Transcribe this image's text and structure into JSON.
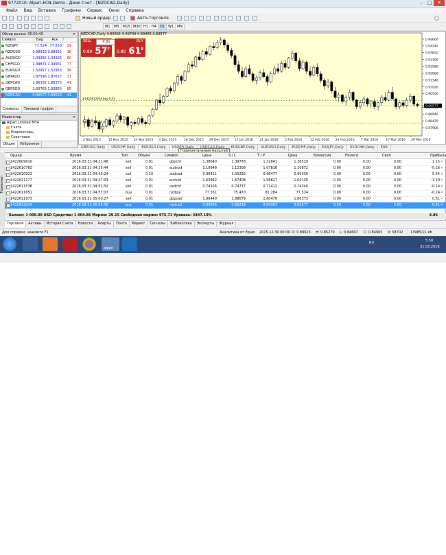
{
  "window": {
    "title": "9772010: Alpari-ECN-Demo - Демо Счет - [NZDCAD,Daily]"
  },
  "menu": [
    "Файл",
    "Вид",
    "Вставка",
    "Графики",
    "Сервис",
    "Окно",
    "Справка"
  ],
  "toolbar": {
    "new_order": "Новый ордер",
    "autotrading": "Авто-торговля"
  },
  "timeframes": [
    "M1",
    "M5",
    "M15",
    "M30",
    "H1",
    "H4",
    "D1",
    "W1",
    "MN"
  ],
  "market_watch": {
    "header": "Обзор рынка: 05:50:43",
    "col_symbol": "Символ",
    "col_bid": "Бид",
    "col_ask": "Аск",
    "rows": [
      {
        "sym": "NZDJPY",
        "bid": "77.524",
        "ask": "77.553",
        "spr": "29"
      },
      {
        "sym": "NZDUSD",
        "bid": "0.68933",
        "ask": "0.68951",
        "spr": "18"
      },
      {
        "sym": "AUDSGD",
        "bid": "1.03265",
        "ask": "1.03325",
        "spr": "60"
      },
      {
        "sym": "CHFSGD",
        "bid": "1.39874",
        "ask": "1.39951",
        "spr": "77"
      },
      {
        "sym": "EURSGD",
        "bid": "1.52917",
        "ask": "1.52953",
        "spr": "36"
      },
      {
        "sym": "GBPAUD",
        "bid": "1.87596",
        "ask": "1.87627",
        "spr": "31"
      },
      {
        "sym": "GBPCAD",
        "bid": "1.86332",
        "ask": "1.86373",
        "spr": "41"
      },
      {
        "sym": "GBPSGD",
        "bid": "1.93765",
        "ask": "1.93850",
        "spr": "85"
      },
      {
        "sym": "NZDCAD",
        "bid": "0.89577",
        "ask": "0.89618",
        "spr": "41"
      }
    ],
    "tabs": [
      "Символы",
      "Тиковый график"
    ]
  },
  "navigator": {
    "header": "Навигатор",
    "items": [
      "Alpari Limited MT4",
      "Счета",
      "Индикаторы",
      "Советники"
    ],
    "tabs": [
      "Общие",
      "Избранное"
    ]
  },
  "chart": {
    "title": "NZDCAD,Daily  0.89691 0.89799 0.89465 0.89577",
    "sell_label": "SELL",
    "buy_label": "BUY",
    "lot": "0.01",
    "sell_price_small": "0.89",
    "sell_price_big": "57",
    "sell_sup": "7",
    "buy_price_small": "0.89",
    "buy_price_big": "61",
    "buy_sup": "8",
    "order_line_label": "#1422612034 buy 0.01",
    "order_line_label2": "#1422612034 sl",
    "price_labels": [
      "0.94660",
      "0.94140",
      "0.93620",
      "0.93100",
      "0.92580",
      "0.92060",
      "0.91540",
      "0.91020",
      "0.90500",
      "0.89577",
      "0.89460",
      "0.88940",
      "0.88420",
      "0.87900"
    ],
    "date_labels": [
      "2 Nov 2015",
      "12 Nov 2015",
      "24 Nov 2015",
      "4 Dec 2015",
      "16 Dec 2015",
      "29 Dec 2015",
      "11 Jan 2016",
      "21 Jan 2016",
      "2 Feb 2016",
      "12 Feb 2016",
      "24 Feb 2016",
      "7 Mar 2016",
      "17 Mar 2016",
      "29 Mar 2016"
    ],
    "tabs": [
      "GBPUSD,Daily",
      "USDCHF,Daily",
      "EURUSD,Daily",
      "USDJPY,Daily",
      "USDCAD,Daily",
      "EURGBP,Daily",
      "AUDUSD,Daily",
      "EURCHF,Daily",
      "EURJPY,Daily",
      "USDCNH,Daily",
      "EUR"
    ],
    "tooltip": "Горизонтальный масштаб"
  },
  "chart_data": {
    "type": "candlestick",
    "title": "NZDCAD,Daily",
    "ylim": [
      0.8738,
      0.9492
    ],
    "current_price": 0.89577,
    "order_level": 0.8996,
    "candles": [
      [
        0.884,
        0.888,
        0.879,
        0.885
      ],
      [
        0.885,
        0.887,
        0.878,
        0.88
      ],
      [
        0.88,
        0.886,
        0.879,
        0.884
      ],
      [
        0.884,
        0.888,
        0.881,
        0.883
      ],
      [
        0.883,
        0.884,
        0.876,
        0.878
      ],
      [
        0.878,
        0.882,
        0.875,
        0.88
      ],
      [
        0.88,
        0.886,
        0.879,
        0.885
      ],
      [
        0.885,
        0.887,
        0.88,
        0.881
      ],
      [
        0.881,
        0.885,
        0.879,
        0.884
      ],
      [
        0.884,
        0.89,
        0.882,
        0.888
      ],
      [
        0.888,
        0.89,
        0.883,
        0.885
      ],
      [
        0.885,
        0.888,
        0.882,
        0.887
      ],
      [
        0.887,
        0.888,
        0.879,
        0.881
      ],
      [
        0.881,
        0.884,
        0.878,
        0.883
      ],
      [
        0.883,
        0.885,
        0.88,
        0.882
      ],
      [
        0.882,
        0.887,
        0.881,
        0.886
      ],
      [
        0.886,
        0.888,
        0.881,
        0.883
      ],
      [
        0.883,
        0.885,
        0.88,
        0.882
      ],
      [
        0.882,
        0.889,
        0.881,
        0.888
      ],
      [
        0.888,
        0.894,
        0.887,
        0.893
      ],
      [
        0.893,
        0.901,
        0.892,
        0.9
      ],
      [
        0.9,
        0.905,
        0.896,
        0.898
      ],
      [
        0.898,
        0.904,
        0.897,
        0.903
      ],
      [
        0.903,
        0.91,
        0.902,
        0.909
      ],
      [
        0.909,
        0.911,
        0.905,
        0.907
      ],
      [
        0.907,
        0.914,
        0.906,
        0.913
      ],
      [
        0.913,
        0.92,
        0.911,
        0.918
      ],
      [
        0.918,
        0.919,
        0.912,
        0.915
      ],
      [
        0.915,
        0.923,
        0.914,
        0.922
      ],
      [
        0.922,
        0.929,
        0.921,
        0.927
      ],
      [
        0.927,
        0.93,
        0.924,
        0.926
      ],
      [
        0.926,
        0.934,
        0.925,
        0.933
      ],
      [
        0.933,
        0.937,
        0.93,
        0.931
      ],
      [
        0.931,
        0.938,
        0.93,
        0.937
      ],
      [
        0.937,
        0.94,
        0.933,
        0.935
      ],
      [
        0.935,
        0.942,
        0.934,
        0.941
      ],
      [
        0.941,
        0.944,
        0.938,
        0.94
      ],
      [
        0.94,
        0.946,
        0.939,
        0.944
      ],
      [
        0.944,
        0.948,
        0.942,
        0.946
      ],
      [
        0.946,
        0.947,
        0.94,
        0.942
      ],
      [
        0.942,
        0.944,
        0.936,
        0.938
      ],
      [
        0.938,
        0.94,
        0.932,
        0.934
      ],
      [
        0.934,
        0.936,
        0.925,
        0.927
      ],
      [
        0.927,
        0.93,
        0.92,
        0.922
      ],
      [
        0.922,
        0.925,
        0.916,
        0.918
      ],
      [
        0.918,
        0.926,
        0.917,
        0.924
      ],
      [
        0.924,
        0.927,
        0.919,
        0.92
      ],
      [
        0.92,
        0.922,
        0.913,
        0.915
      ],
      [
        0.915,
        0.919,
        0.912,
        0.917
      ],
      [
        0.917,
        0.923,
        0.915,
        0.921
      ],
      [
        0.921,
        0.924,
        0.917,
        0.918
      ],
      [
        0.918,
        0.92,
        0.911,
        0.914
      ],
      [
        0.914,
        0.922,
        0.913,
        0.92
      ],
      [
        0.92,
        0.926,
        0.919,
        0.924
      ],
      [
        0.924,
        0.928,
        0.92,
        0.922
      ],
      [
        0.922,
        0.93,
        0.921,
        0.928
      ],
      [
        0.928,
        0.931,
        0.923,
        0.925
      ],
      [
        0.925,
        0.933,
        0.924,
        0.932
      ],
      [
        0.932,
        0.938,
        0.93,
        0.936
      ],
      [
        0.936,
        0.937,
        0.928,
        0.93
      ],
      [
        0.93,
        0.932,
        0.922,
        0.924
      ],
      [
        0.924,
        0.931,
        0.923,
        0.929
      ],
      [
        0.929,
        0.93,
        0.92,
        0.922
      ],
      [
        0.922,
        0.926,
        0.917,
        0.919
      ],
      [
        0.919,
        0.927,
        0.918,
        0.925
      ],
      [
        0.925,
        0.928,
        0.918,
        0.92
      ],
      [
        0.92,
        0.922,
        0.913,
        0.915
      ],
      [
        0.915,
        0.917,
        0.908,
        0.911
      ],
      [
        0.911,
        0.916,
        0.909,
        0.914
      ],
      [
        0.914,
        0.915,
        0.905,
        0.907
      ],
      [
        0.907,
        0.91,
        0.9,
        0.902
      ],
      [
        0.902,
        0.906,
        0.899,
        0.904
      ],
      [
        0.904,
        0.905,
        0.897,
        0.899
      ],
      [
        0.899,
        0.904,
        0.896,
        0.902
      ],
      [
        0.902,
        0.908,
        0.9,
        0.906
      ],
      [
        0.906,
        0.907,
        0.898,
        0.9
      ],
      [
        0.9,
        0.901,
        0.893,
        0.895
      ],
      [
        0.895,
        0.9,
        0.893,
        0.898
      ],
      [
        0.898,
        0.903,
        0.896,
        0.901
      ],
      [
        0.901,
        0.902,
        0.895,
        0.897
      ],
      [
        0.897,
        0.9,
        0.894,
        0.899
      ],
      [
        0.899,
        0.901,
        0.893,
        0.895
      ],
      [
        0.895,
        0.899,
        0.892,
        0.898
      ],
      [
        0.898,
        0.904,
        0.896,
        0.902
      ],
      [
        0.902,
        0.906,
        0.899,
        0.9
      ],
      [
        0.9,
        0.908,
        0.899,
        0.906
      ],
      [
        0.906,
        0.91,
        0.9,
        0.901
      ],
      [
        0.901,
        0.902,
        0.893,
        0.895
      ],
      [
        0.895,
        0.899,
        0.893,
        0.898
      ],
      [
        0.898,
        0.9,
        0.894,
        0.896
      ],
      [
        0.896,
        0.902,
        0.895,
        0.9
      ],
      [
        0.9,
        0.905,
        0.898,
        0.903
      ],
      [
        0.903,
        0.904,
        0.895,
        0.8969
      ],
      [
        0.8969,
        0.898,
        0.8946,
        0.8958
      ]
    ]
  },
  "trades": {
    "columns": [
      "Ордер",
      "Время",
      "Тип",
      "Объем",
      "Символ",
      "Цена",
      "S / L",
      "T / P",
      "Цена",
      "Комиссия",
      "Налоги",
      "Своп",
      "Прибыль"
    ],
    "rows": [
      [
        "1422609910",
        "2016.03.31 04:21:48",
        "sell",
        "0.01",
        "gbpchf",
        "1.38640",
        "1.39778",
        "1.31841",
        "1.38529",
        "0.00",
        "0.00",
        "0.00",
        "1.15"
      ],
      [
        "1422610783",
        "2016.03.31 04:35:44",
        "sell",
        "0.01",
        "audnzd",
        "1.10848",
        "1.12308",
        "1.07816",
        "1.10872",
        "0.00",
        "0.00",
        "0.00",
        "-0.16"
      ],
      [
        "1422610923",
        "2016.03.31 04:40:24",
        "sell",
        "0.10",
        "audcad",
        "0.99411",
        "1.00292",
        "0.96477",
        "0.99339",
        "0.00",
        "0.00",
        "0.00",
        "5.54"
      ],
      [
        "1422611177",
        "2016.03.31 04:47:03",
        "sell",
        "0.01",
        "eurnzd",
        "1.63962",
        "1.67408",
        "1.58827",
        "1.64135",
        "0.00",
        "0.00",
        "0.00",
        "-1.19"
      ],
      [
        "1422611538",
        "2016.03.31 04:52:32",
        "sell",
        "0.01",
        "cadchf",
        "0.74326",
        "0.74737",
        "0.71412",
        "0.74340",
        "0.00",
        "0.00",
        "0.00",
        "-0.14"
      ],
      [
        "1422611651",
        "2016.03.31 04:57:07",
        "buy",
        "0.01",
        "nzdjpy",
        "77.551",
        "75.470",
        "81.284",
        "77.524",
        "0.00",
        "0.00",
        "0.00",
        "-0.24"
      ],
      [
        "1422611973",
        "2016.03.31 05:00:27",
        "sell",
        "0.01",
        "gbpcad",
        "1.86440",
        "1.88679",
        "1.80479",
        "1.86373",
        "0.00",
        "0.00",
        "0.00",
        "0.51"
      ],
      [
        "1422612034",
        "2016.03.31 05:02:45",
        "buy",
        "0.01",
        "nzdcad",
        "0.89656",
        "0.88239",
        "0.94301",
        "0.89577",
        "0.00",
        "0.00",
        "0.00",
        "-0.61"
      ]
    ],
    "balance": "Баланс: 1 000.00 USD  Средства: 1 004.86  Маржа: 29.15  Свободная маржа: 975.71  Уровень: 3447.10%",
    "total_profit": "4.86",
    "tabs": [
      "Торговля",
      "Активы",
      "История Счета",
      "Новости",
      "Алерты",
      "Почта",
      "Маркет",
      "Сигналы",
      "Библиотека",
      "Эксперты",
      "Журнал"
    ],
    "side_label": "Терминал"
  },
  "status": {
    "help": "Для справки, нажмите F1",
    "profile": "Аналитика от Ершо",
    "time": "2015.12.30 00:00",
    "open": "O: 0.89023",
    "high": "H: 0.85270",
    "low": "L: 0.84697",
    "close": "C: 0.84905",
    "volume": "V: 58702",
    "traffic": "13985/21 kb"
  },
  "taskbar": {
    "lang": "RU",
    "clock": "5:50",
    "date": "31.03.2016",
    "alpari": "alpari"
  },
  "colors": {
    "sell": "#c62828",
    "buy": "#c62828",
    "selected": "#3399ff",
    "chart_bg": "#ffffd2",
    "up_candle": "#ffffff",
    "down_candle": "#000000"
  }
}
